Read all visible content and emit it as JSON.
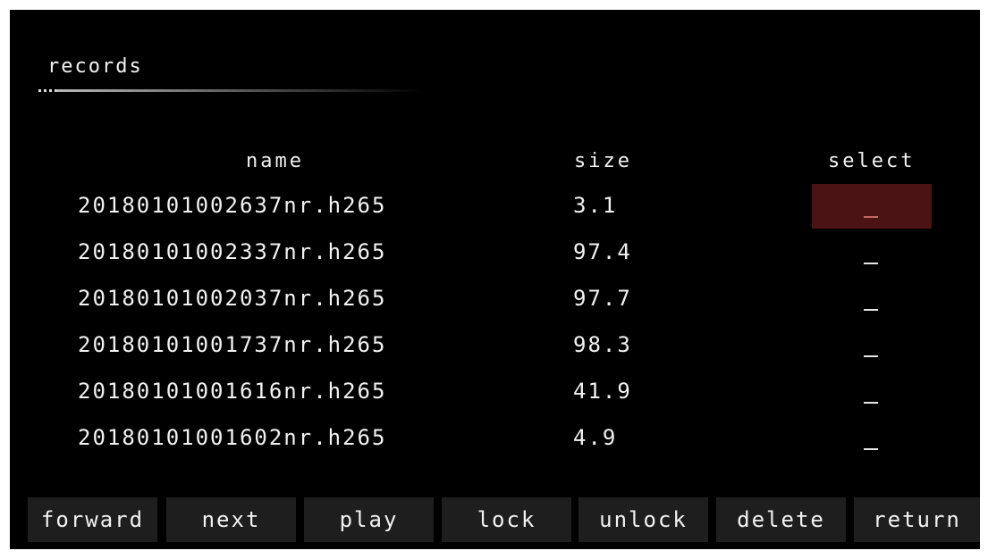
{
  "title": "records",
  "columns": {
    "name": "name",
    "size": "size",
    "select": "select"
  },
  "rows": [
    {
      "name": "20180101002637nr.h265",
      "size": "3.1",
      "selected": true,
      "mark": "_"
    },
    {
      "name": "20180101002337nr.h265",
      "size": "97.4",
      "selected": false,
      "mark": "_"
    },
    {
      "name": "20180101002037nr.h265",
      "size": "97.7",
      "selected": false,
      "mark": "_"
    },
    {
      "name": "20180101001737nr.h265",
      "size": "98.3",
      "selected": false,
      "mark": "_"
    },
    {
      "name": "20180101001616nr.h265",
      "size": "41.9",
      "selected": false,
      "mark": "_"
    },
    {
      "name": "20180101001602nr.h265",
      "size": "4.9",
      "selected": false,
      "mark": "_"
    }
  ],
  "buttons": {
    "forward": "forward",
    "next": "next",
    "play": "play",
    "lock": "lock",
    "unlock": "unlock",
    "delete": "delete",
    "return": "return"
  },
  "colors": {
    "background": "#000000",
    "text": "#f2f2f2",
    "selected_highlight": "#4b1414",
    "button_background": "#1e1e1e"
  }
}
